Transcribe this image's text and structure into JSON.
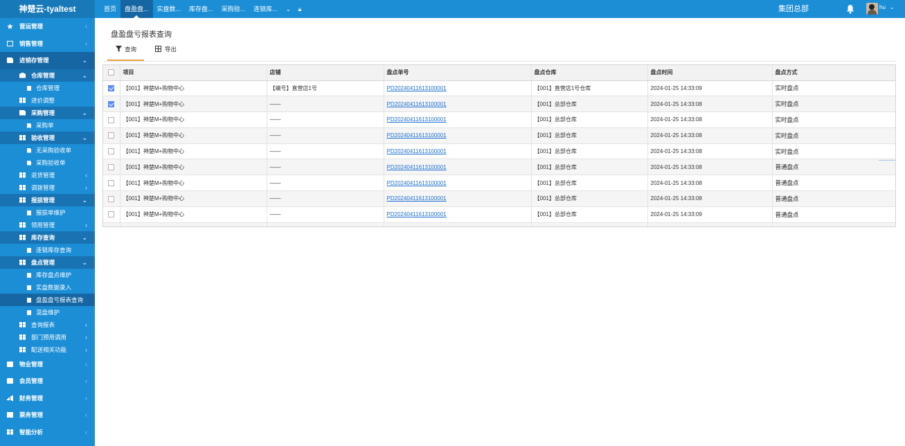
{
  "app": {
    "title": "神楚云-tyaltest"
  },
  "topnav": {
    "tabs": [
      {
        "label": "首页",
        "active": false
      },
      {
        "label": "盘盈盘...",
        "active": true
      },
      {
        "label": "实盘数...",
        "active": false
      },
      {
        "label": "库存盘...",
        "active": false
      },
      {
        "label": "采购验...",
        "active": false
      },
      {
        "label": "连锁库...",
        "active": false
      }
    ],
    "more_icon": "chevron-down-icon",
    "lock_icon": "lock-icon"
  },
  "header": {
    "org": "集团总部",
    "bell_icon": "bell-icon",
    "user": "hu",
    "user_caret": "chevron-down-icon"
  },
  "sidebar": {
    "items": [
      {
        "level": 1,
        "label": "营运管理",
        "icon": "star-icon",
        "caret": "‹",
        "open": false
      },
      {
        "level": 1,
        "label": "销售管理",
        "icon": "image-icon",
        "caret": "‹",
        "open": false
      },
      {
        "level": 1,
        "label": "进销存管理",
        "icon": "truck-icon",
        "caret": "⌄",
        "open": true
      },
      {
        "level": 2,
        "label": "仓库管理",
        "icon": "bank-icon",
        "caret": "⌄",
        "open": true
      },
      {
        "level": 3,
        "label": "仓库管理",
        "icon": "square-icon",
        "active": false
      },
      {
        "level": 2,
        "label": "进价调整",
        "icon": "windows-icon",
        "caret": "",
        "open": false
      },
      {
        "level": 2,
        "label": "采购管理",
        "icon": "file-icon",
        "caret": "⌄",
        "open": true
      },
      {
        "level": 3,
        "label": "采购单",
        "icon": "file-icon",
        "active": false
      },
      {
        "level": 2,
        "label": "验收管理",
        "icon": "windows-icon",
        "caret": "⌄",
        "open": true
      },
      {
        "level": 3,
        "label": "无采购验收单",
        "icon": "file-icon",
        "active": false
      },
      {
        "level": 3,
        "label": "采购验收单",
        "icon": "file-icon",
        "active": false
      },
      {
        "level": 2,
        "label": "退货管理",
        "icon": "windows-icon",
        "caret": "‹",
        "open": false
      },
      {
        "level": 2,
        "label": "调拨管理",
        "icon": "windows-icon",
        "caret": "‹",
        "open": false
      },
      {
        "level": 2,
        "label": "报损管理",
        "icon": "windows-icon",
        "caret": "⌄",
        "open": true
      },
      {
        "level": 3,
        "label": "报损单维护",
        "icon": "square-icon",
        "active": false
      },
      {
        "level": 2,
        "label": "领用管理",
        "icon": "windows-icon",
        "caret": "‹",
        "open": false
      },
      {
        "level": 2,
        "label": "库存查询",
        "icon": "windows-icon",
        "caret": "⌄",
        "open": true
      },
      {
        "level": 3,
        "label": "连锁库存查询",
        "icon": "square-icon",
        "active": false
      },
      {
        "level": 2,
        "label": "盘点管理",
        "icon": "windows-icon",
        "caret": "⌄",
        "open": true
      },
      {
        "level": 3,
        "label": "库存盘点维护",
        "icon": "square-icon",
        "active": false
      },
      {
        "level": 3,
        "label": "实盘数据录入",
        "icon": "square-icon",
        "active": false
      },
      {
        "level": 3,
        "label": "盘盈盘亏报表查询",
        "icon": "square-icon",
        "active": true
      },
      {
        "level": 3,
        "label": "混盘维护",
        "icon": "square-icon",
        "active": false
      },
      {
        "level": 2,
        "label": "查询报表",
        "icon": "windows-icon",
        "caret": "‹",
        "open": false
      },
      {
        "level": 2,
        "label": "部门预用调用",
        "icon": "windows-icon",
        "caret": "‹",
        "open": false
      },
      {
        "level": 2,
        "label": "配送相关功能",
        "icon": "windows-icon",
        "caret": "‹",
        "open": false
      },
      {
        "level": 1,
        "label": "物业管理",
        "icon": "briefcase-icon",
        "caret": "‹",
        "open": false
      },
      {
        "level": 1,
        "label": "会员管理",
        "icon": "vip-icon",
        "caret": "‹",
        "open": false
      },
      {
        "level": 1,
        "label": "财务管理",
        "icon": "bar-chart-icon",
        "caret": "‹",
        "open": false
      },
      {
        "level": 1,
        "label": "票务管理",
        "icon": "ticket-icon",
        "caret": "‹",
        "open": false
      },
      {
        "level": 1,
        "label": "智能分析",
        "icon": "analysis-icon",
        "caret": "‹",
        "open": false
      }
    ]
  },
  "page": {
    "title": "盘盈盘亏报表查询",
    "toolbar": {
      "query_label": "查询",
      "export_label": "导出",
      "query_icon": "filter-icon",
      "export_icon": "table-icon"
    }
  },
  "table": {
    "headers": [
      "项目",
      "店铺",
      "盘点单号",
      "盘点仓库",
      "盘点时间",
      "盘点方式"
    ],
    "rows": [
      {
        "checked": true,
        "project": "【001】神楚M+购物中心",
        "store": "【编号】直营店1号",
        "order": "PD20240411613100001",
        "warehouse": "【001】直营店1号仓库",
        "time": "2024-01-25 14:33:09",
        "mode": "实时盘点"
      },
      {
        "checked": true,
        "project": "【001】神楚M+购物中心",
        "store": "——",
        "order": "PD20240411613100001",
        "warehouse": "【001】总部仓库",
        "time": "2024-01-25 14:33:08",
        "mode": "实时盘点"
      },
      {
        "checked": false,
        "project": "【001】神楚M+购物中心",
        "store": "——",
        "order": "PD20240411613100001",
        "warehouse": "【001】总部仓库",
        "time": "2024-01-25 14:33:08",
        "mode": "实时盘点"
      },
      {
        "checked": false,
        "project": "【001】神楚M+购物中心",
        "store": "——",
        "order": "PD20240411613100001",
        "warehouse": "【001】总部仓库",
        "time": "2024-01-25 14:33:08",
        "mode": "实时盘点"
      },
      {
        "checked": false,
        "project": "【001】神楚M+购物中心",
        "store": "——",
        "order": "PD20240411613100001",
        "warehouse": "【001】总部仓库",
        "time": "2024-01-25 14:33:08",
        "mode": "实时盘点"
      },
      {
        "checked": false,
        "project": "【001】神楚M+购物中心",
        "store": "——",
        "order": "PD20240411613100001",
        "warehouse": "【001】总部仓库",
        "time": "2024-01-25 14:33:08",
        "mode": "普通盘点"
      },
      {
        "checked": false,
        "project": "【001】神楚M+购物中心",
        "store": "——",
        "order": "PD20240411613100001",
        "warehouse": "【001】总部仓库",
        "time": "2024-01-25 14:33:08",
        "mode": "普通盘点"
      },
      {
        "checked": false,
        "project": "【001】神楚M+购物中心",
        "store": "——",
        "order": "PD20240411613100001",
        "warehouse": "【001】总部仓库",
        "time": "2024-01-25 14:33:08",
        "mode": "普通盘点"
      },
      {
        "checked": false,
        "project": "【001】神楚M+购物中心",
        "store": "——",
        "order": "PD20240411613100001",
        "warehouse": "【001】总部仓库",
        "time": "2024-01-25 14:33:09",
        "mode": "普通盘点"
      }
    ]
  },
  "colors": {
    "primary": "#1b8ed6",
    "sidebar_active": "#1566a3",
    "accent": "#f0a040",
    "link": "#1e6fd0",
    "checkbox": "#5b8cf0"
  }
}
